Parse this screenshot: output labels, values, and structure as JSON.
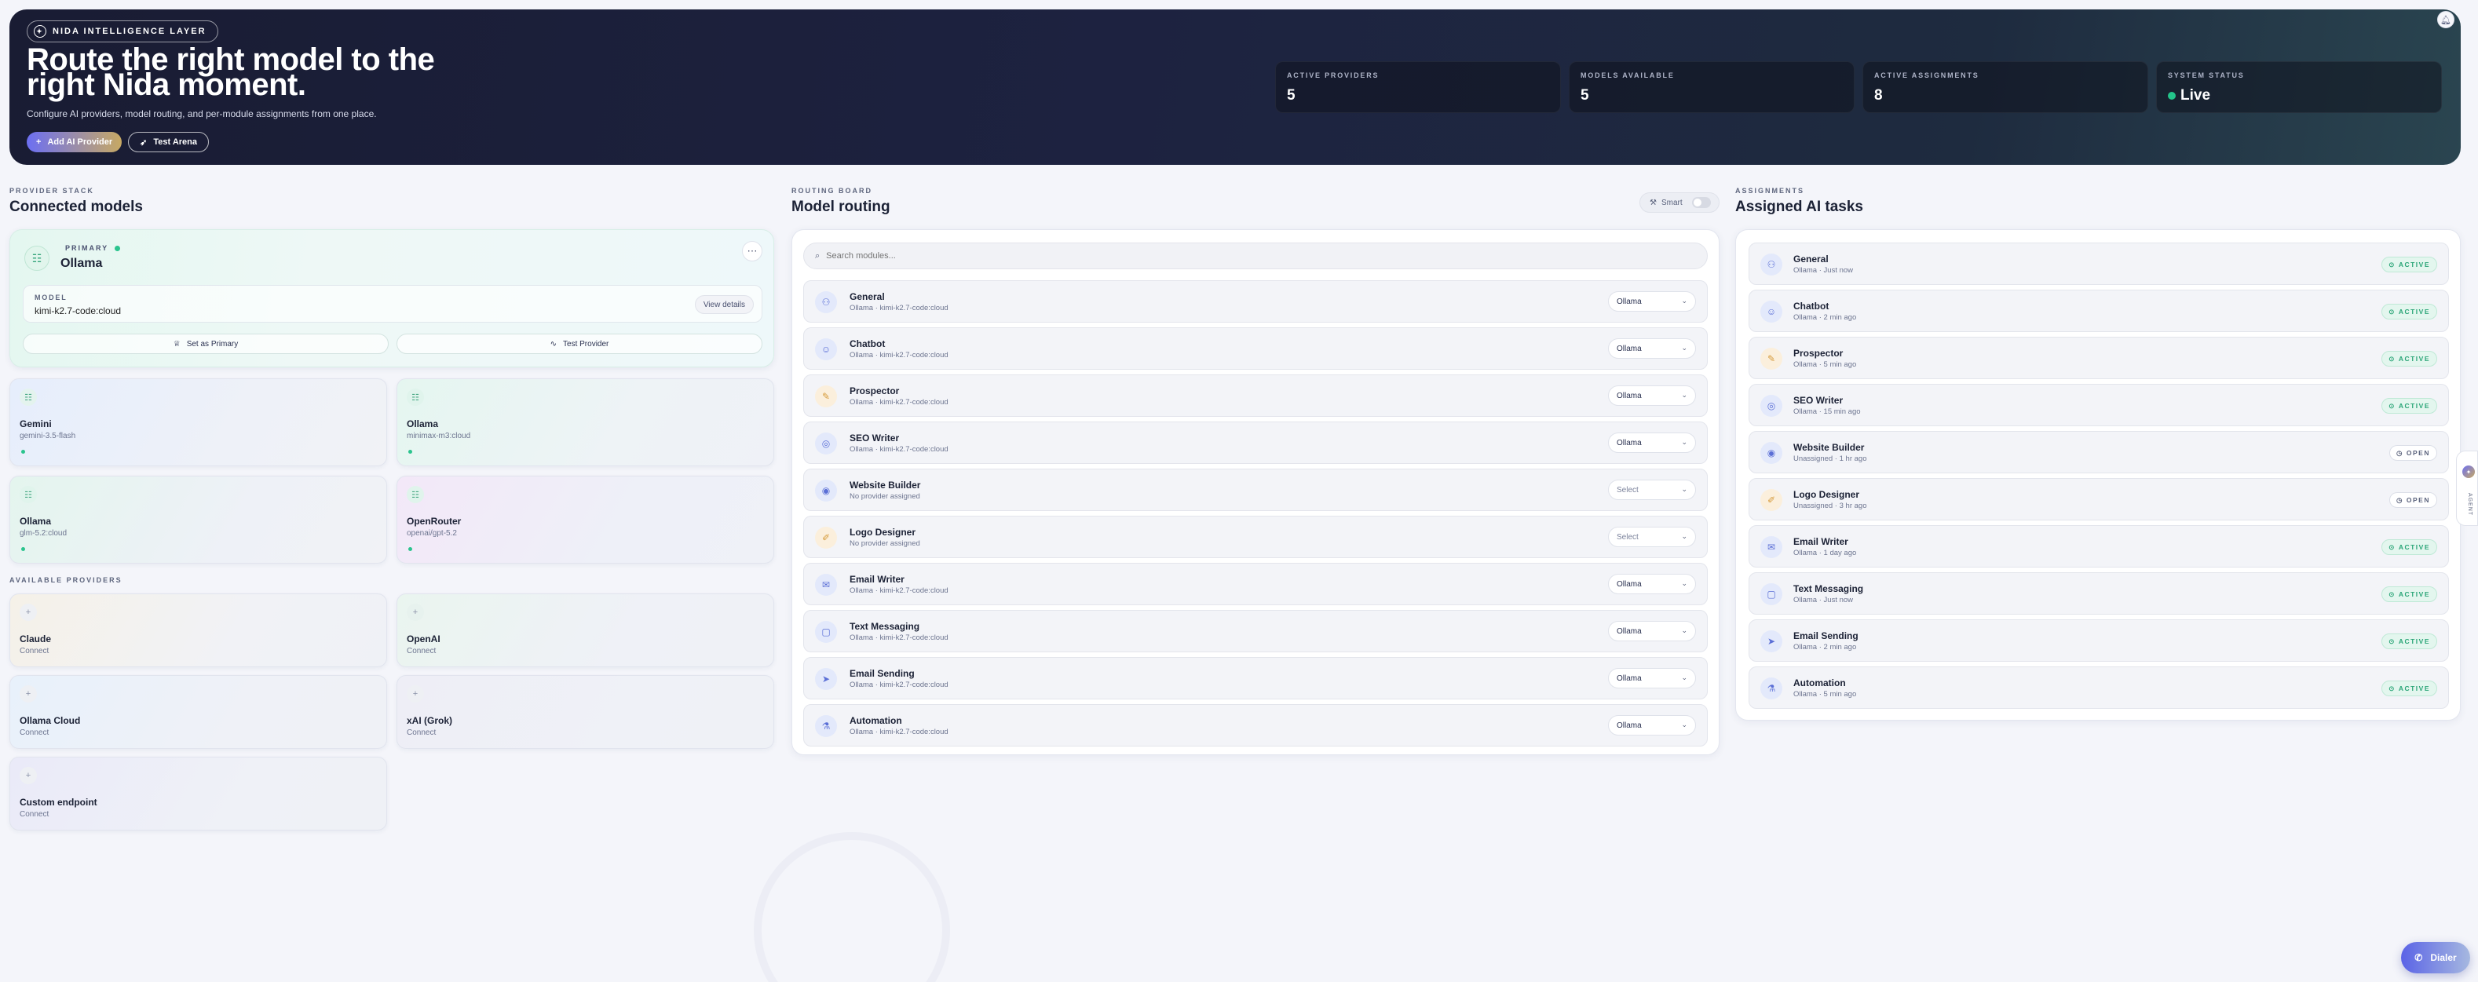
{
  "hero": {
    "eyebrow": "NIDA INTELLIGENCE LAYER",
    "title": "Route the right model to the right Nida moment.",
    "subtitle": "Configure AI providers, model routing, and per-module assignments from one place.",
    "add_provider_label": "Add AI Provider",
    "test_arena_label": "Test Arena",
    "stats": [
      {
        "label": "ACTIVE PROVIDERS",
        "value": "5"
      },
      {
        "label": "MODELS AVAILABLE",
        "value": "5"
      },
      {
        "label": "ACTIVE ASSIGNMENTS",
        "value": "8"
      },
      {
        "label": "SYSTEM STATUS",
        "value": "Live"
      }
    ]
  },
  "provider_stack": {
    "eyebrow": "PROVIDER STACK",
    "title": "Connected models",
    "primary": {
      "tag": "PRIMARY",
      "name": "Ollama",
      "model_label": "MODEL",
      "model_value": "kimi-k2.7-code:cloud",
      "view_details_label": "View details",
      "set_primary_label": "Set as Primary",
      "test_provider_label": "Test Provider"
    },
    "connected": [
      {
        "name": "Gemini",
        "model": "gemini-3.5-flash"
      },
      {
        "name": "Ollama",
        "model": "minimax-m3:cloud"
      },
      {
        "name": "Ollama",
        "model": "glm-5.2:cloud"
      },
      {
        "name": "OpenRouter",
        "model": "openai/gpt-5.2"
      }
    ],
    "available_eyebrow": "AVAILABLE PROVIDERS",
    "available": [
      {
        "name": "Claude",
        "action": "Connect"
      },
      {
        "name": "OpenAI",
        "action": "Connect"
      },
      {
        "name": "Ollama Cloud",
        "action": "Connect"
      },
      {
        "name": "xAI (Grok)",
        "action": "Connect"
      },
      {
        "name": "Custom endpoint",
        "action": "Connect"
      }
    ]
  },
  "routing": {
    "eyebrow": "ROUTING BOARD",
    "title": "Model routing",
    "smart_label": "Smart",
    "search_placeholder": "Search modules...",
    "rows": [
      {
        "name": "General",
        "sub": "Ollama · kimi-k2.7-code:cloud",
        "select": "Ollama"
      },
      {
        "name": "Chatbot",
        "sub": "Ollama · kimi-k2.7-code:cloud",
        "select": "Ollama"
      },
      {
        "name": "Prospector",
        "sub": "Ollama · kimi-k2.7-code:cloud",
        "select": "Ollama"
      },
      {
        "name": "SEO Writer",
        "sub": "Ollama · kimi-k2.7-code:cloud",
        "select": "Ollama"
      },
      {
        "name": "Website Builder",
        "sub": "No provider assigned",
        "select": "Select"
      },
      {
        "name": "Logo Designer",
        "sub": "No provider assigned",
        "select": "Select"
      },
      {
        "name": "Email Writer",
        "sub": "Ollama · kimi-k2.7-code:cloud",
        "select": "Ollama"
      },
      {
        "name": "Text Messaging",
        "sub": "Ollama · kimi-k2.7-code:cloud",
        "select": "Ollama"
      },
      {
        "name": "Email Sending",
        "sub": "Ollama · kimi-k2.7-code:cloud",
        "select": "Ollama"
      },
      {
        "name": "Automation",
        "sub": "Ollama · kimi-k2.7-code:cloud",
        "select": "Ollama"
      }
    ]
  },
  "assignments": {
    "eyebrow": "ASSIGNMENTS",
    "title": "Assigned AI tasks",
    "rows": [
      {
        "name": "General",
        "sub": "Ollama · Just now",
        "status": "ACTIVE"
      },
      {
        "name": "Chatbot",
        "sub": "Ollama · 2 min ago",
        "status": "ACTIVE"
      },
      {
        "name": "Prospector",
        "sub": "Ollama · 5 min ago",
        "status": "ACTIVE"
      },
      {
        "name": "SEO Writer",
        "sub": "Ollama · 15 min ago",
        "status": "ACTIVE"
      },
      {
        "name": "Website Builder",
        "sub": "Unassigned · 1 hr ago",
        "status": "OPEN"
      },
      {
        "name": "Logo Designer",
        "sub": "Unassigned · 3 hr ago",
        "status": "OPEN"
      },
      {
        "name": "Email Writer",
        "sub": "Ollama · 1 day ago",
        "status": "ACTIVE"
      },
      {
        "name": "Text Messaging",
        "sub": "Ollama · Just now",
        "status": "ACTIVE"
      },
      {
        "name": "Email Sending",
        "sub": "Ollama · 2 min ago",
        "status": "ACTIVE"
      },
      {
        "name": "Automation",
        "sub": "Ollama · 5 min ago",
        "status": "ACTIVE"
      }
    ]
  },
  "side_tab_label": "AGENT",
  "dialer_label": "Dialer",
  "colors": {
    "accent": "#6c6ff3",
    "gold": "#c7a963",
    "success": "#2bc48e",
    "hero_bg": "#1d2240"
  }
}
